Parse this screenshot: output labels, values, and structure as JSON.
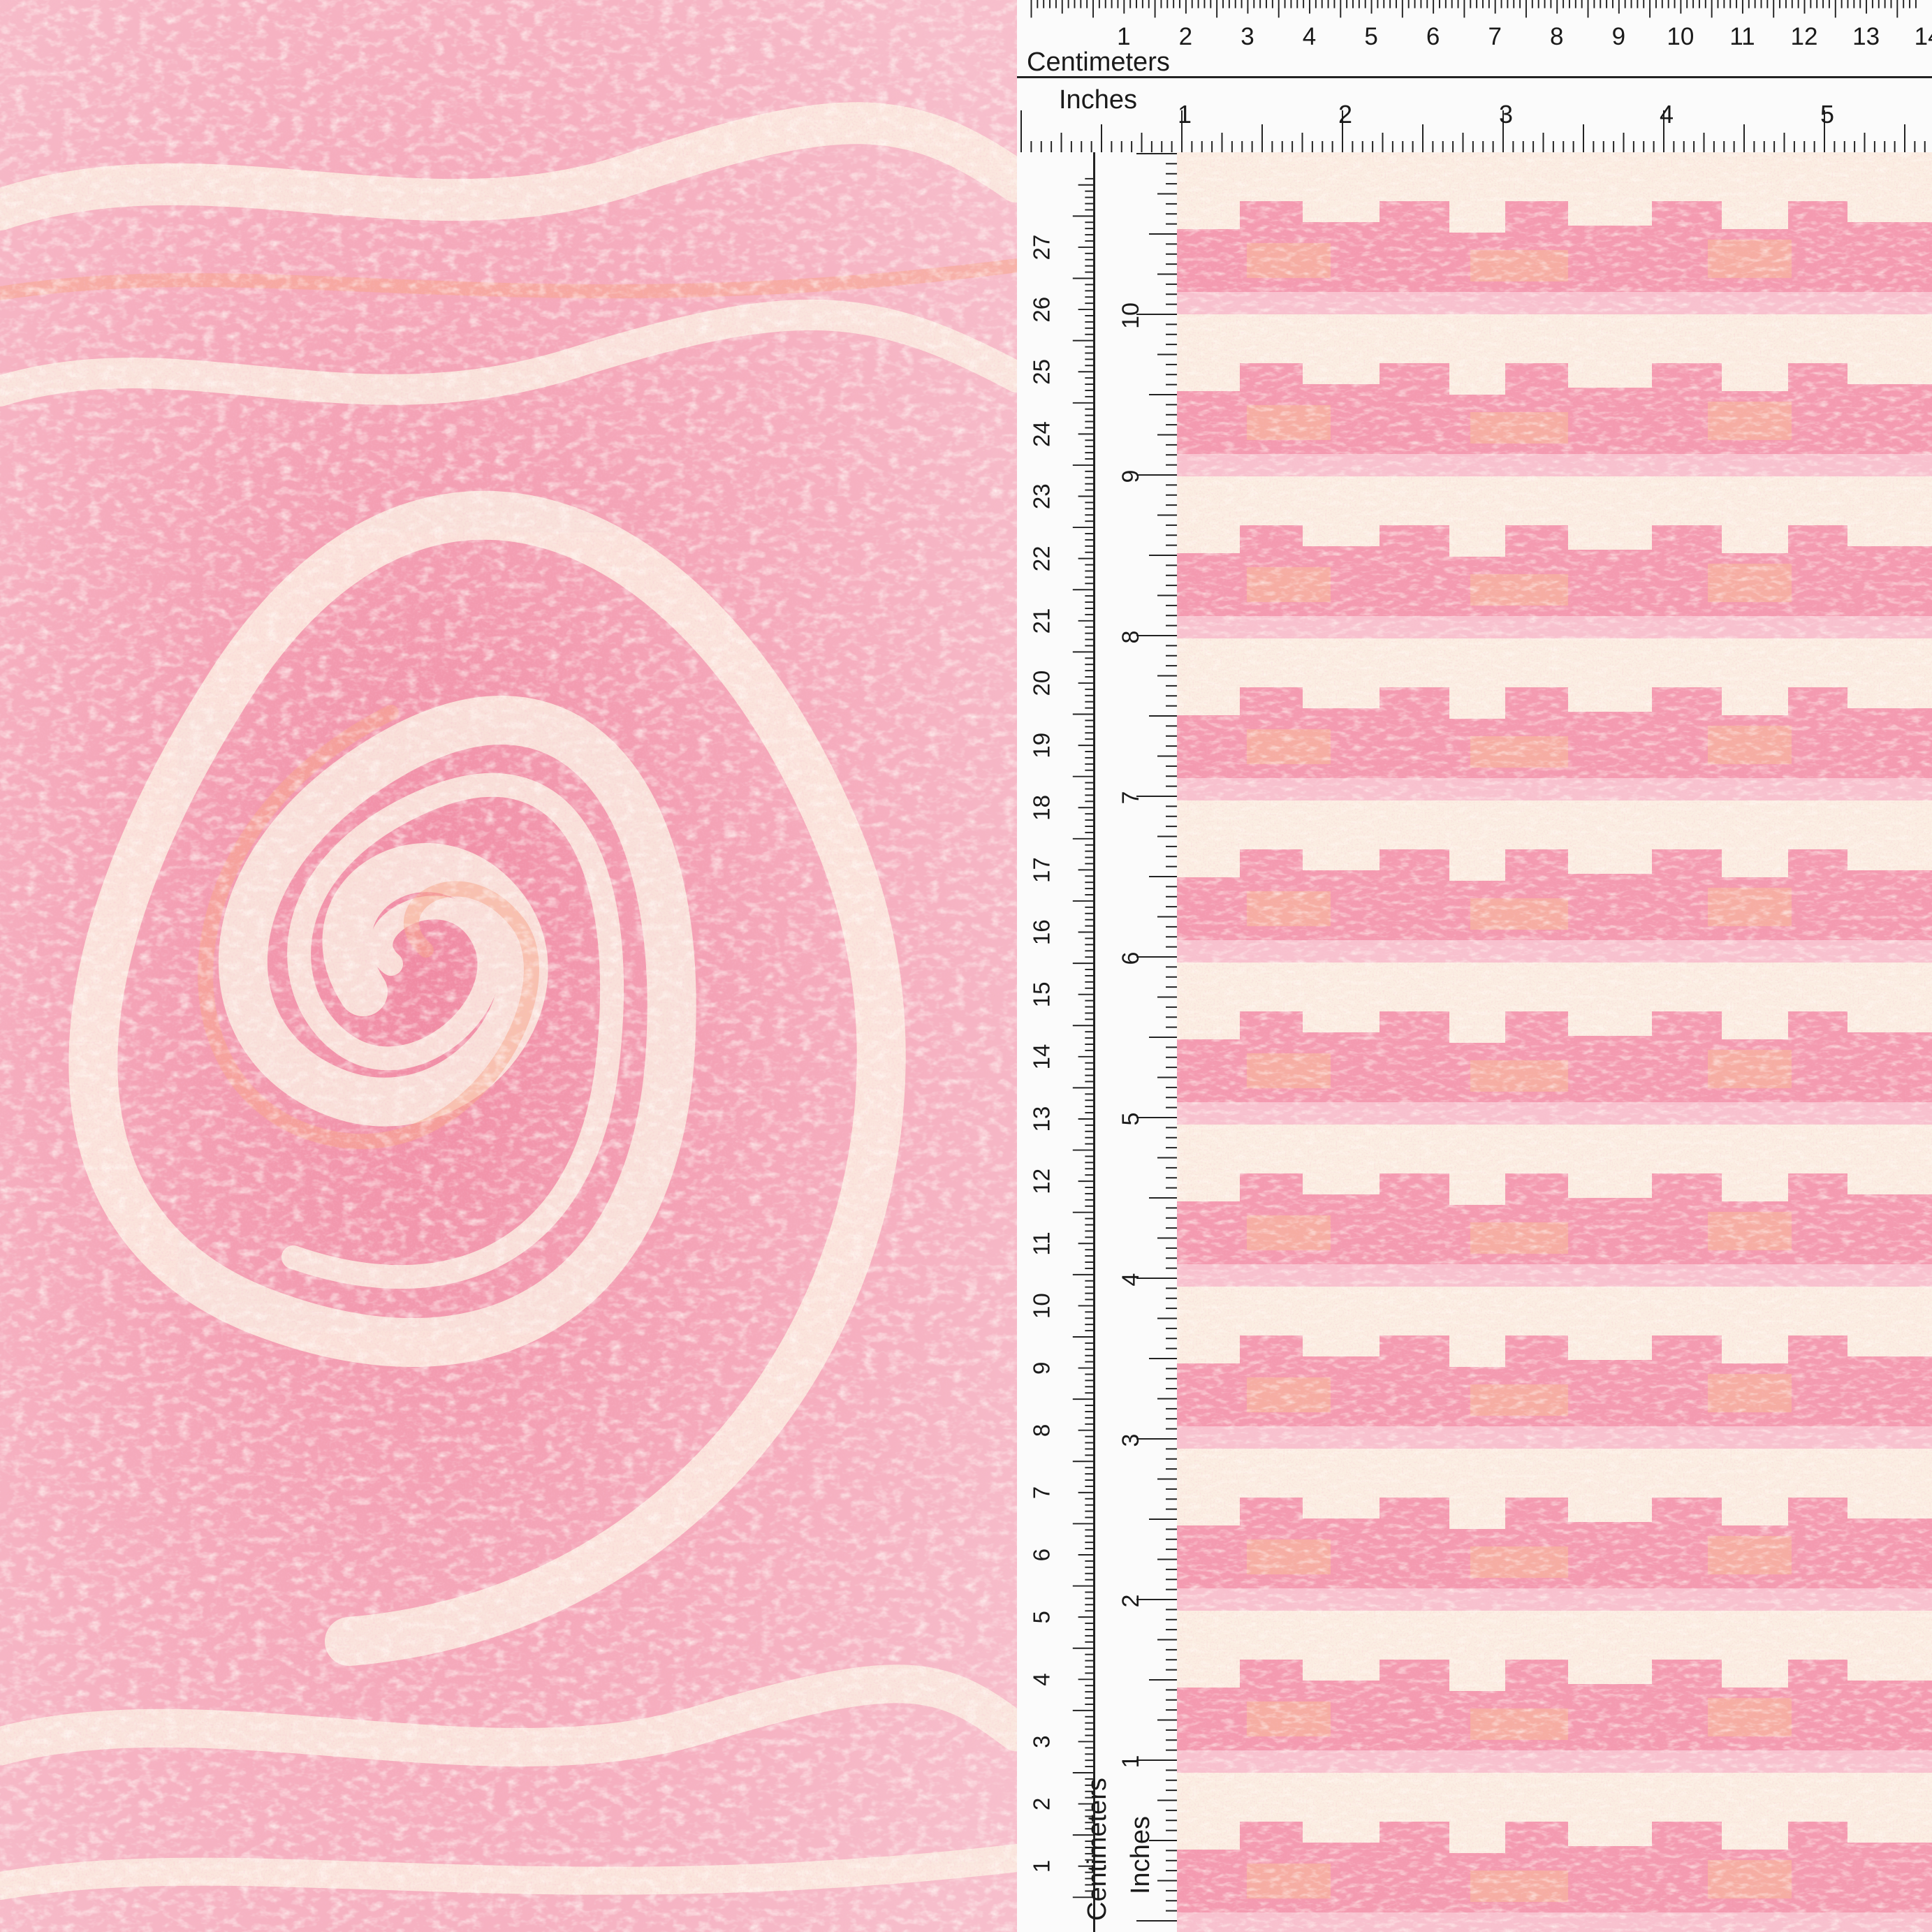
{
  "image": {
    "subject": "pink and cream textured knit fabric",
    "colors": {
      "pink": "#f49ab0",
      "pink_light": "#f8c2cf",
      "cream": "#fbeee2",
      "peach": "#f9b79a",
      "gold_thread": "#d9bf8c"
    }
  },
  "rulers": {
    "horizontal_cm": {
      "unit_label": "Centimeters",
      "ticks": [
        "1",
        "2",
        "3",
        "4",
        "5",
        "6",
        "7",
        "8",
        "9",
        "10",
        "11",
        "12",
        "13",
        "14"
      ]
    },
    "horizontal_in": {
      "unit_label": "Inches",
      "ticks": [
        "1",
        "2",
        "3",
        "4",
        "5"
      ]
    },
    "vertical_cm": {
      "unit_label": "Centimeters",
      "ticks": [
        "1",
        "2",
        "3",
        "4",
        "5",
        "6",
        "7",
        "8",
        "9",
        "10",
        "11",
        "12",
        "13",
        "14",
        "15",
        "16",
        "17",
        "18",
        "19",
        "20",
        "21",
        "22",
        "23",
        "24",
        "25",
        "26",
        "27"
      ]
    },
    "vertical_in": {
      "unit_label": "Inches",
      "ticks": [
        "1",
        "2",
        "3",
        "4",
        "5",
        "6",
        "7",
        "8",
        "9",
        "10"
      ]
    }
  }
}
